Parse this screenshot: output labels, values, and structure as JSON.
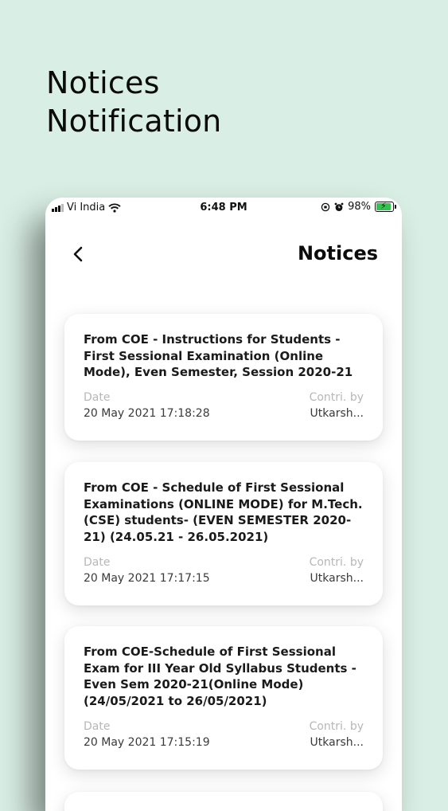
{
  "promo": {
    "line1": "Notices",
    "line2": "Notification"
  },
  "statusbar": {
    "carrier": "Vi India",
    "time": "6:48 PM",
    "battery": "98%",
    "battery_level": 0.98
  },
  "header": {
    "title": "Notices",
    "back_icon": "chevron-left-icon"
  },
  "notices": [
    {
      "title": "From COE - Instructions for Students - First Sessional Examination (Online Mode), Even Semester, Session 2020-21",
      "date_label": "Date",
      "date": "20 May 2021 17:18:28",
      "contrib_label": "Contri. by",
      "contributor": "Utkarsh..."
    },
    {
      "title": "From COE - Schedule of First Sessional Examinations (ONLINE MODE) for M.Tech.(CSE) students- (EVEN SEMESTER 2020-21) (24.05.21 - 26.05.2021)",
      "date_label": "Date",
      "date": "20 May 2021 17:17:15",
      "contrib_label": "Contri. by",
      "contributor": "Utkarsh..."
    },
    {
      "title": "From COE-Schedule of First Sessional Exam for III Year Old Syllabus Students -Even Sem 2020-21(Online Mode) (24/05/2021 to 26/05/2021)",
      "date_label": "Date",
      "date": "20 May 2021 17:15:19",
      "contrib_label": "Contri. by",
      "contributor": "Utkarsh..."
    }
  ]
}
